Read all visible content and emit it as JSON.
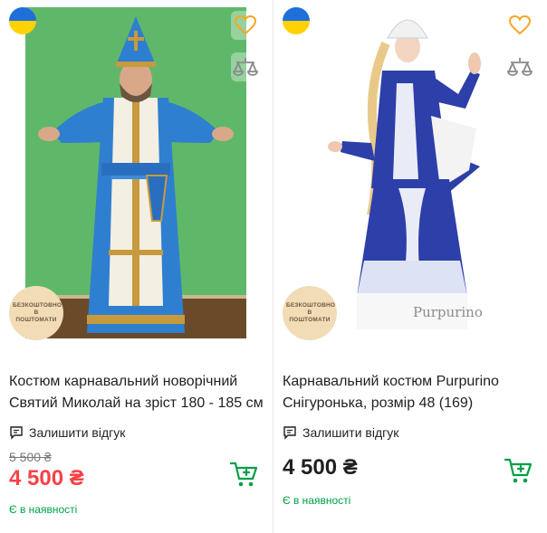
{
  "products": [
    {
      "title": "Костюм карнавальний новорічний Святий Миколай на зріст 180 - 185 см",
      "review_label": "Залишити відгук",
      "old_price": "5 500 ₴",
      "price": "4 500 ₴",
      "availability": "Є в наявності",
      "badge": "БЕЗКОШТОВНО В ПОШТОМАТИ",
      "image_icon": "saint-nicholas-costume-photo"
    },
    {
      "title": "Карнавальний костюм Purpurino Снігуронька, розмір 48 (169)",
      "review_label": "Залишити відгук",
      "old_price": "",
      "price": "4 500 ₴",
      "availability": "Є в наявності",
      "badge": "БЕЗКОШТОВНО В ПОШТОМАТИ",
      "watermark": "Purpurino",
      "image_icon": "snow-maiden-costume-photo"
    }
  ],
  "colors": {
    "accent_green": "#00a046",
    "sale_red": "#f84147",
    "heart_orange": "#f5a623",
    "flag_blue": "#1e6fd9",
    "flag_yellow": "#ffd200"
  }
}
